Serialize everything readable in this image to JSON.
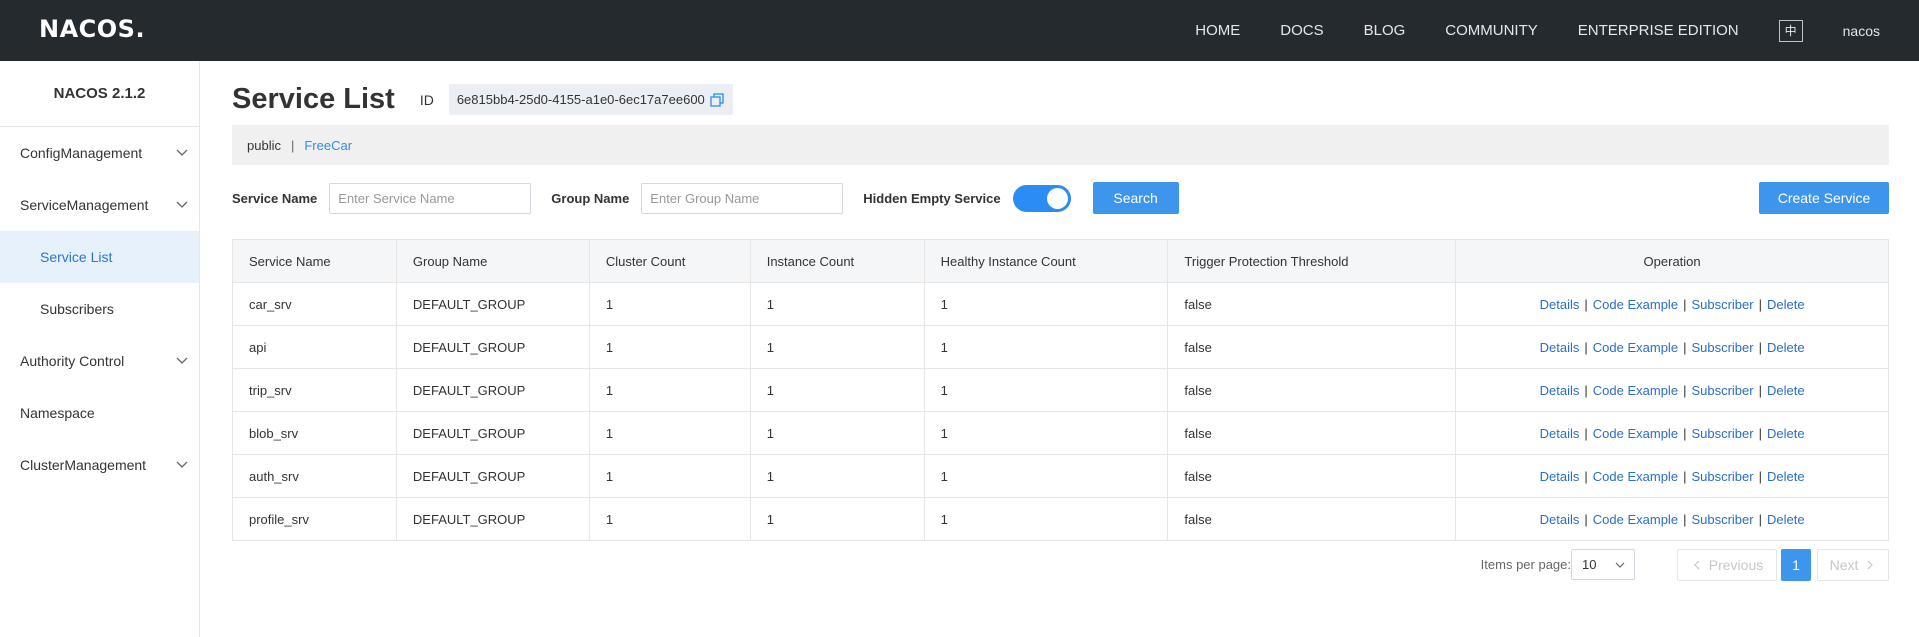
{
  "header": {
    "logo": "NACOS.",
    "nav": [
      "HOME",
      "DOCS",
      "BLOG",
      "COMMUNITY",
      "ENTERPRISE EDITION"
    ],
    "lang": "中",
    "user": "nacos"
  },
  "sidebar": {
    "version": "NACOS 2.1.2",
    "items": [
      {
        "label": "ConfigManagement",
        "has_children": true
      },
      {
        "label": "ServiceManagement",
        "has_children": true
      },
      {
        "label": "Service List",
        "sub": true,
        "active": true
      },
      {
        "label": "Subscribers",
        "sub": true
      },
      {
        "label": "Authority Control",
        "has_children": true
      },
      {
        "label": "Namespace"
      },
      {
        "label": "ClusterManagement",
        "has_children": true
      }
    ]
  },
  "page": {
    "title": "Service List",
    "id_label": "ID",
    "namespace_id": "6e815bb4-25d0-4155-a1e0-6ec17a7ee600"
  },
  "namespaces": {
    "public": "public",
    "separator": "|",
    "freecar": "FreeCar"
  },
  "filters": {
    "service_name_label": "Service Name",
    "service_name_placeholder": "Enter Service Name",
    "group_name_label": "Group Name",
    "group_name_placeholder": "Enter Group Name",
    "hidden_empty_label": "Hidden Empty Service",
    "hidden_empty_on": true,
    "search_label": "Search",
    "create_label": "Create Service"
  },
  "table": {
    "columns": [
      "Service Name",
      "Group Name",
      "Cluster Count",
      "Instance Count",
      "Healthy Instance Count",
      "Trigger Protection Threshold",
      "Operation"
    ],
    "operations": [
      "Details",
      "Code Example",
      "Subscriber",
      "Delete"
    ],
    "rows": [
      [
        "car_srv",
        "DEFAULT_GROUP",
        "1",
        "1",
        "1",
        "false"
      ],
      [
        "api",
        "DEFAULT_GROUP",
        "1",
        "1",
        "1",
        "false"
      ],
      [
        "trip_srv",
        "DEFAULT_GROUP",
        "1",
        "1",
        "1",
        "false"
      ],
      [
        "blob_srv",
        "DEFAULT_GROUP",
        "1",
        "1",
        "1",
        "false"
      ],
      [
        "auth_srv",
        "DEFAULT_GROUP",
        "1",
        "1",
        "1",
        "false"
      ],
      [
        "profile_srv",
        "DEFAULT_GROUP",
        "1",
        "1",
        "1",
        "false"
      ]
    ]
  },
  "pagination": {
    "items_per_page_label": "Items per page:",
    "items_per_page": "10",
    "prev": "Previous",
    "current": "1",
    "next": "Next"
  },
  "colors": {
    "header_bg": "#252a2f",
    "primary": "#3d95ec",
    "link": "#2a6ecb",
    "active_bg": "#e7f1fc"
  }
}
